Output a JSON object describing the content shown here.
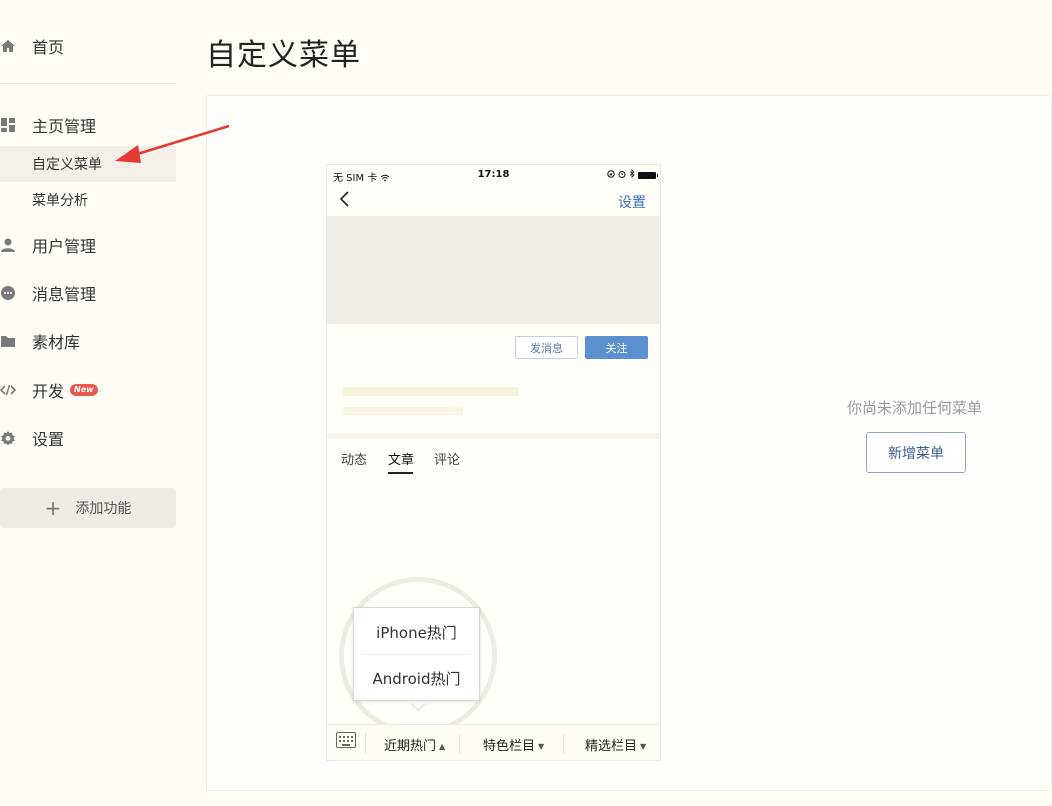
{
  "sidebar": {
    "home": "首页",
    "homepage_mgmt": "主页管理",
    "sub_custom_menu": "自定义菜单",
    "sub_menu_analysis": "菜单分析",
    "user_mgmt": "用户管理",
    "message_mgmt": "消息管理",
    "material_lib": "素材库",
    "develop": "开发",
    "new_badge": "New",
    "settings": "设置",
    "add_function": "添加功能"
  },
  "page": {
    "title": "自定义菜单"
  },
  "phone": {
    "carrier": "无 SIM 卡",
    "time": "17:18",
    "nav_settings": "设置",
    "btn_message": "发消息",
    "btn_follow": "关注",
    "tabs": [
      "动态",
      "文章",
      "评论"
    ],
    "popup_options": [
      "iPhone热门",
      "Android热门"
    ],
    "menu_items": [
      "近期热门",
      "特色栏目",
      "精选栏目"
    ]
  },
  "empty_state": {
    "text": "你尚未添加任何菜单",
    "add_button": "新增菜单"
  },
  "colors": {
    "background": "#fffdf6",
    "accent_blue": "#5b8fd0",
    "arrow_red": "#e53935"
  }
}
